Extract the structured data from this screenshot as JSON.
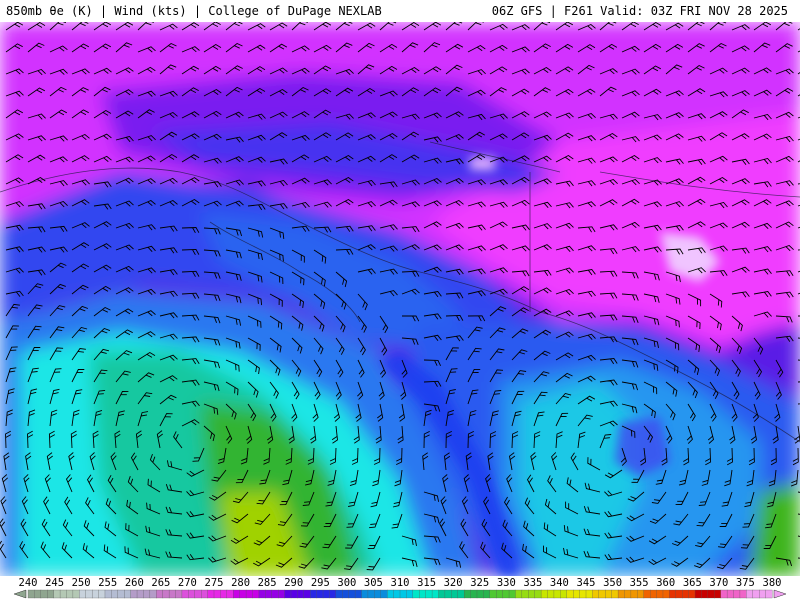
{
  "header": {
    "left": "850mb θe (K) | Wind (kts) | College of DuPage NEXLAB",
    "right": "06Z GFS | F261 Valid: 03Z FRI NOV 28 2025"
  },
  "colorbar": {
    "labels": [
      "240",
      "245",
      "250",
      "255",
      "260",
      "265",
      "270",
      "275",
      "280",
      "285",
      "290",
      "295",
      "300",
      "305",
      "310",
      "315",
      "320",
      "325",
      "330",
      "335",
      "340",
      "345",
      "350",
      "355",
      "360",
      "365",
      "370",
      "375",
      "380"
    ],
    "colors": [
      "#8fa58f",
      "#b4c8b4",
      "#c8d2dc",
      "#b4bcd2",
      "#b49cc8",
      "#c878c8",
      "#dc50dc",
      "#e628e6",
      "#c800e6",
      "#9600e6",
      "#5a00e6",
      "#2828e6",
      "#1450dc",
      "#0a8cdc",
      "#00c8e6",
      "#00e6c8",
      "#00c896",
      "#28b450",
      "#50c832",
      "#96dc14",
      "#c8e600",
      "#e6e600",
      "#f0c800",
      "#f09600",
      "#f06400",
      "#e63200",
      "#c80000",
      "#f064c8",
      "#f0a0f0"
    ]
  },
  "map_colors": {
    "magenta": "#e632ff",
    "violet": "#8c1ef0",
    "purple_blue": "#6428f0",
    "blue": "#3c3cf0",
    "mid_blue": "#2a6ef0",
    "light_blue": "#28a0f0",
    "cyan": "#1ee6e6",
    "teal": "#14c8a0",
    "green": "#32b432",
    "yellow_green": "#a0d200"
  }
}
